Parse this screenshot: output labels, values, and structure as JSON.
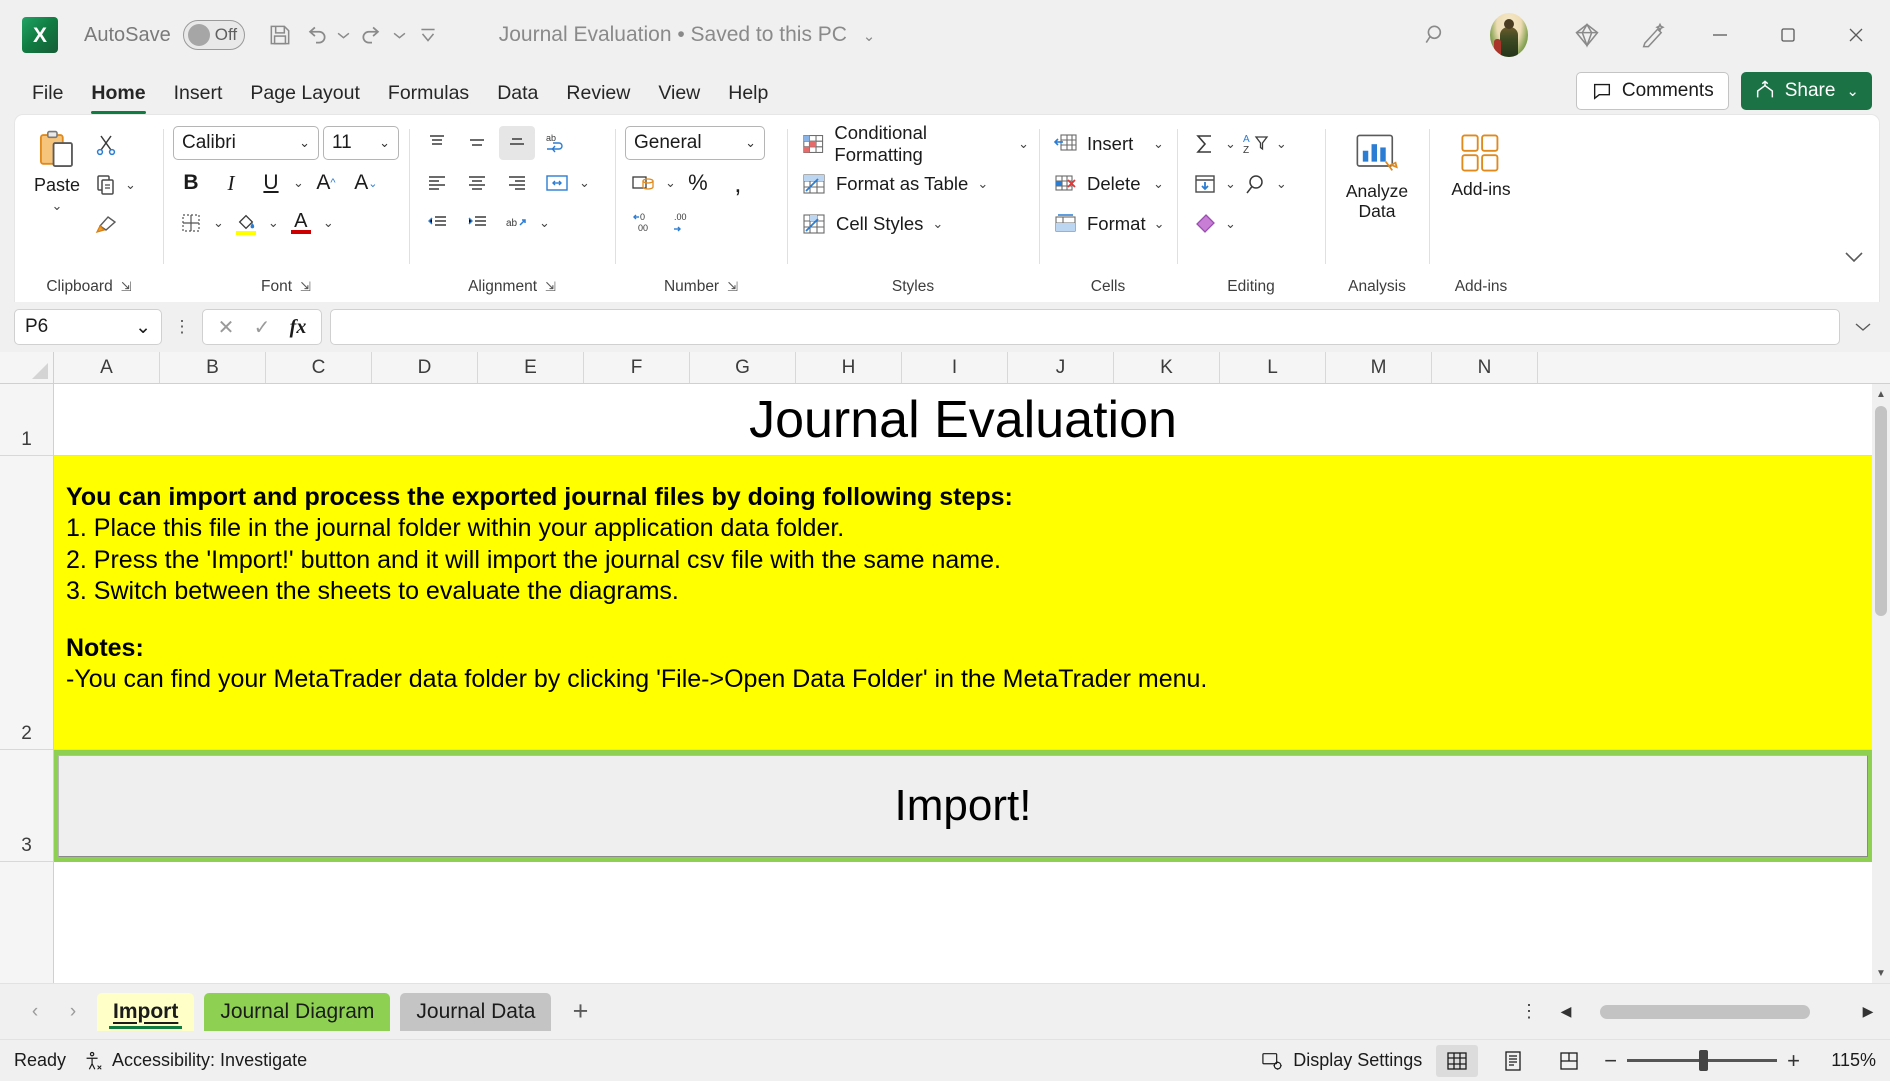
{
  "titlebar": {
    "autosave_label": "AutoSave",
    "autosave_state": "Off",
    "document_title": "Journal Evaluation • Saved to this PC",
    "app_name": "Excel",
    "logo_letter": "X"
  },
  "ribbon_tabs": [
    {
      "label": "File",
      "active": false
    },
    {
      "label": "Home",
      "active": true
    },
    {
      "label": "Insert",
      "active": false
    },
    {
      "label": "Page Layout",
      "active": false
    },
    {
      "label": "Formulas",
      "active": false
    },
    {
      "label": "Data",
      "active": false
    },
    {
      "label": "Review",
      "active": false
    },
    {
      "label": "View",
      "active": false
    },
    {
      "label": "Help",
      "active": false
    }
  ],
  "ribbon_actions": {
    "comments_label": "Comments",
    "share_label": "Share"
  },
  "ribbon": {
    "clipboard": {
      "group_label": "Clipboard",
      "paste_label": "Paste"
    },
    "font": {
      "group_label": "Font",
      "font_name": "Calibri",
      "font_size": "11",
      "bold": "B",
      "italic": "I",
      "underline": "U",
      "grow_font": "A",
      "shrink_font": "A"
    },
    "alignment": {
      "group_label": "Alignment"
    },
    "number": {
      "group_label": "Number",
      "format": "General",
      "percent": "%",
      "comma": ","
    },
    "styles": {
      "group_label": "Styles",
      "conditional_formatting": "Conditional Formatting",
      "format_as_table": "Format as Table",
      "cell_styles": "Cell Styles"
    },
    "cells": {
      "group_label": "Cells",
      "insert": "Insert",
      "delete": "Delete",
      "format": "Format"
    },
    "editing": {
      "group_label": "Editing"
    },
    "analysis": {
      "group_label": "Analysis",
      "analyze_data": "Analyze Data"
    },
    "addins": {
      "group_label": "Add-ins",
      "addins_label": "Add-ins"
    }
  },
  "formula_bar": {
    "name_box": "P6",
    "formula_value": ""
  },
  "grid": {
    "columns": [
      "A",
      "B",
      "C",
      "D",
      "E",
      "F",
      "G",
      "H",
      "I",
      "J",
      "K",
      "L",
      "M",
      "N"
    ],
    "rows": [
      "1",
      "2",
      "3"
    ],
    "cells": {
      "title": "Journal Evaluation",
      "instructions_heading": "You can import and process the exported journal files by doing following steps:",
      "step_1": "1. Place this file in the journal folder within your application data folder.",
      "step_2": "2. Press the 'Import!' button and it will import the journal csv file with the same name.",
      "step_3": "3. Switch between the sheets to evaluate the diagrams.",
      "notes_heading": "Notes:",
      "note_1": "-You can find your MetaTrader data folder by clicking 'File->Open Data Folder' in the MetaTrader menu.",
      "import_button": "Import!"
    },
    "colors": {
      "instructions_background": "#ffff00",
      "import_row_background": "#8ed152",
      "import_button_background": "#efefef"
    }
  },
  "sheet_tabs": [
    {
      "label": "Import",
      "state": "active"
    },
    {
      "label": "Journal Diagram",
      "state": "green"
    },
    {
      "label": "Journal Data",
      "state": "gray"
    }
  ],
  "statusbar": {
    "mode": "Ready",
    "accessibility": "Accessibility: Investigate",
    "display_settings": "Display Settings",
    "zoom": "115%",
    "zoom_minus": "−",
    "zoom_plus": "+"
  }
}
